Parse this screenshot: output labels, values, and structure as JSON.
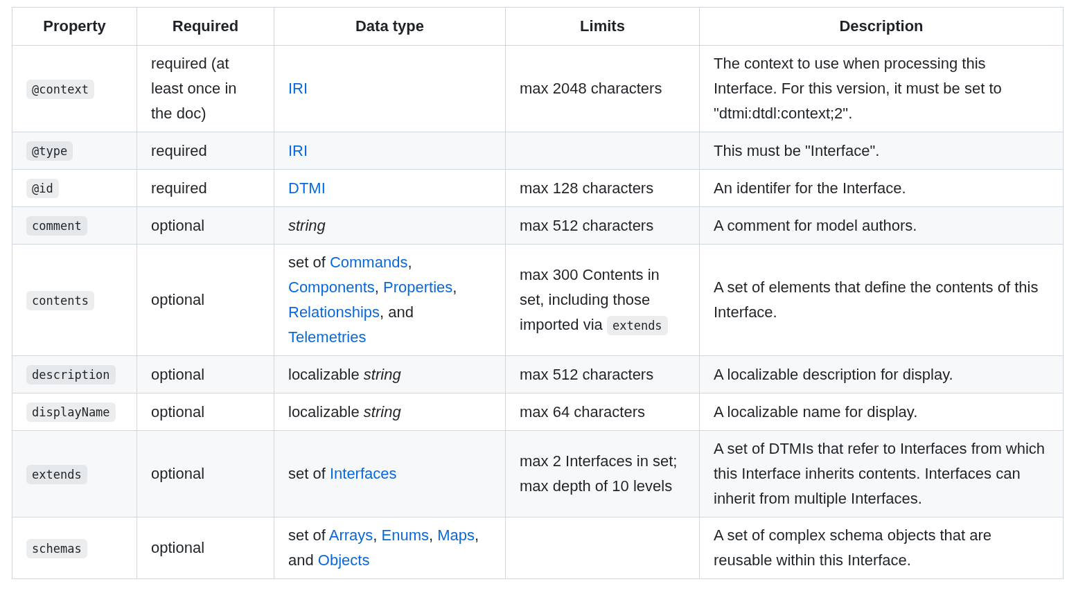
{
  "table": {
    "columns": [
      "Property",
      "Required",
      "Data type",
      "Limits",
      "Description"
    ],
    "rows": [
      {
        "property": "@context",
        "required": "required (at least once in the doc)",
        "data_type": [
          {
            "kind": "link",
            "text": "IRI"
          }
        ],
        "limits": [
          {
            "kind": "text",
            "text": "max 2048 characters"
          }
        ],
        "description": "The context to use when processing this Interface. For this version, it must be set to \"dtmi:dtdl:context;2\"."
      },
      {
        "property": "@type",
        "required": "required",
        "data_type": [
          {
            "kind": "link",
            "text": "IRI"
          }
        ],
        "limits": [],
        "description": "This must be \"Interface\"."
      },
      {
        "property": "@id",
        "required": "required",
        "data_type": [
          {
            "kind": "link",
            "text": "DTMI"
          }
        ],
        "limits": [
          {
            "kind": "text",
            "text": "max 128 characters"
          }
        ],
        "description": "An identifer for the Interface."
      },
      {
        "property": "comment",
        "required": "optional",
        "data_type": [
          {
            "kind": "italic",
            "text": "string"
          }
        ],
        "limits": [
          {
            "kind": "text",
            "text": "max 512 characters"
          }
        ],
        "description": "A comment for model authors."
      },
      {
        "property": "contents",
        "required": "optional",
        "data_type": [
          {
            "kind": "text",
            "text": "set of "
          },
          {
            "kind": "link",
            "text": "Commands"
          },
          {
            "kind": "text",
            "text": ", "
          },
          {
            "kind": "link",
            "text": "Components"
          },
          {
            "kind": "text",
            "text": ", "
          },
          {
            "kind": "link",
            "text": "Properties"
          },
          {
            "kind": "text",
            "text": ", "
          },
          {
            "kind": "link",
            "text": "Relationships"
          },
          {
            "kind": "text",
            "text": ", and "
          },
          {
            "kind": "link",
            "text": "Telemetries"
          }
        ],
        "limits": [
          {
            "kind": "text",
            "text": "max 300 Contents in set, including those imported via "
          },
          {
            "kind": "code",
            "text": "extends"
          }
        ],
        "description": "A set of elements that define the contents of this Interface."
      },
      {
        "property": "description",
        "required": "optional",
        "data_type": [
          {
            "kind": "text",
            "text": "localizable "
          },
          {
            "kind": "italic",
            "text": "string"
          }
        ],
        "limits": [
          {
            "kind": "text",
            "text": "max 512 characters"
          }
        ],
        "description": "A localizable description for display."
      },
      {
        "property": "displayName",
        "required": "optional",
        "data_type": [
          {
            "kind": "text",
            "text": "localizable "
          },
          {
            "kind": "italic",
            "text": "string"
          }
        ],
        "limits": [
          {
            "kind": "text",
            "text": "max 64 characters"
          }
        ],
        "description": "A localizable name for display."
      },
      {
        "property": "extends",
        "required": "optional",
        "data_type": [
          {
            "kind": "text",
            "text": "set of "
          },
          {
            "kind": "link",
            "text": "Interfaces"
          }
        ],
        "limits": [
          {
            "kind": "text",
            "text": "max 2 Interfaces in set; max depth of 10 levels"
          }
        ],
        "description": "A set of DTMIs that refer to Interfaces from which this Interface inherits contents. Interfaces can inherit from multiple Interfaces."
      },
      {
        "property": "schemas",
        "required": "optional",
        "data_type": [
          {
            "kind": "text",
            "text": "set of "
          },
          {
            "kind": "link",
            "text": "Arrays"
          },
          {
            "kind": "text",
            "text": ", "
          },
          {
            "kind": "link",
            "text": "Enums"
          },
          {
            "kind": "text",
            "text": ", "
          },
          {
            "kind": "link",
            "text": "Maps"
          },
          {
            "kind": "text",
            "text": ", and "
          },
          {
            "kind": "link",
            "text": "Objects"
          }
        ],
        "limits": [],
        "description": "A set of complex schema objects that are reusable within this Interface."
      }
    ]
  }
}
